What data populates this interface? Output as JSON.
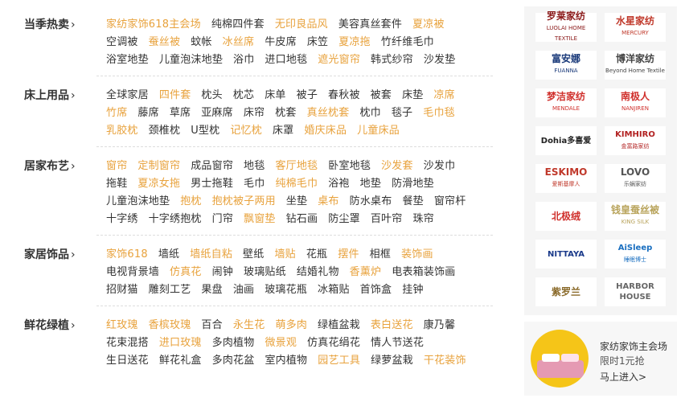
{
  "colors": {
    "highlight": "#e8a23c",
    "normal": "#333333",
    "separator": "#dddddd"
  },
  "categories": [
    {
      "title": "当季热卖",
      "rows": [
        [
          [
            "家纺家饰618主会场",
            true
          ],
          [
            "纯棉四件套",
            false
          ],
          [
            "无印良品风",
            true
          ],
          [
            "美容真丝套件",
            false
          ],
          [
            "夏凉被",
            true
          ]
        ],
        [
          [
            "空调被",
            false
          ],
          [
            "蚕丝被",
            true
          ],
          [
            "蚊帐",
            false
          ],
          [
            "冰丝席",
            true
          ],
          [
            "牛皮席",
            false
          ],
          [
            "床笠",
            false
          ],
          [
            "夏凉拖",
            true
          ],
          [
            "竹纤维毛巾",
            false
          ]
        ],
        [
          [
            "浴室地垫",
            false
          ],
          [
            "儿童泡沫地垫",
            false
          ],
          [
            "浴巾",
            false
          ],
          [
            "进口地毯",
            false
          ],
          [
            "遮光窗帘",
            true
          ],
          [
            "韩式纱帘",
            false
          ],
          [
            "沙发垫",
            false
          ]
        ]
      ]
    },
    {
      "title": "床上用品",
      "rows": [
        [
          [
            "全球家居",
            false
          ],
          [
            "四件套",
            true
          ],
          [
            "枕头",
            false
          ],
          [
            "枕芯",
            false
          ],
          [
            "床单",
            false
          ],
          [
            "被子",
            false
          ],
          [
            "春秋被",
            false
          ],
          [
            "被套",
            false
          ],
          [
            "床垫",
            false
          ],
          [
            "凉席",
            true
          ]
        ],
        [
          [
            "竹席",
            true
          ],
          [
            "藤席",
            false
          ],
          [
            "草席",
            false
          ],
          [
            "亚麻席",
            false
          ],
          [
            "床帘",
            false
          ],
          [
            "枕套",
            false
          ],
          [
            "真丝枕套",
            true
          ],
          [
            "枕巾",
            false
          ],
          [
            "毯子",
            false
          ],
          [
            "毛巾毯",
            true
          ]
        ],
        [
          [
            "乳胶枕",
            true
          ],
          [
            "颈椎枕",
            false
          ],
          [
            "U型枕",
            false
          ],
          [
            "记忆枕",
            true
          ],
          [
            "床罩",
            false
          ],
          [
            "婚庆床品",
            true
          ],
          [
            "儿童床品",
            true
          ]
        ]
      ]
    },
    {
      "title": "居家布艺",
      "rows": [
        [
          [
            "窗帘",
            true
          ],
          [
            "定制窗帘",
            true
          ],
          [
            "成品窗帘",
            false
          ],
          [
            "地毯",
            false
          ],
          [
            "客厅地毯",
            true
          ],
          [
            "卧室地毯",
            false
          ],
          [
            "沙发套",
            true
          ],
          [
            "沙发巾",
            false
          ]
        ],
        [
          [
            "拖鞋",
            false
          ],
          [
            "夏凉女拖",
            true
          ],
          [
            "男士拖鞋",
            false
          ],
          [
            "毛巾",
            false
          ],
          [
            "纯棉毛巾",
            true
          ],
          [
            "浴袍",
            false
          ],
          [
            "地垫",
            false
          ],
          [
            "防滑地垫",
            false
          ]
        ],
        [
          [
            "儿童泡沫地垫",
            false
          ],
          [
            "抱枕",
            true
          ],
          [
            "抱枕被子两用",
            true
          ],
          [
            "坐垫",
            false
          ],
          [
            "桌布",
            true
          ],
          [
            "防水桌布",
            false
          ],
          [
            "餐垫",
            false
          ],
          [
            "窗帘杆",
            false
          ]
        ],
        [
          [
            "十字绣",
            false
          ],
          [
            "十字绣抱枕",
            false
          ],
          [
            "门帘",
            false
          ],
          [
            "飘窗垫",
            true
          ],
          [
            "钻石画",
            false
          ],
          [
            "防尘罩",
            false
          ],
          [
            "百叶帘",
            false
          ],
          [
            "珠帘",
            false
          ]
        ]
      ]
    },
    {
      "title": "家居饰品",
      "rows": [
        [
          [
            "家饰618",
            true
          ],
          [
            "墙纸",
            false
          ],
          [
            "墙纸自粘",
            true
          ],
          [
            "壁纸",
            false
          ],
          [
            "墙贴",
            true
          ],
          [
            "花瓶",
            false
          ],
          [
            "摆件",
            true
          ],
          [
            "相框",
            false
          ],
          [
            "装饰画",
            true
          ]
        ],
        [
          [
            "电视背景墙",
            false
          ],
          [
            "仿真花",
            true
          ],
          [
            "闹钟",
            false
          ],
          [
            "玻璃贴纸",
            false
          ],
          [
            "结婚礼物",
            false
          ],
          [
            "香薰炉",
            true
          ],
          [
            "电表箱装饰画",
            false
          ]
        ],
        [
          [
            "招财猫",
            false
          ],
          [
            "雕刻工艺",
            false
          ],
          [
            "果盘",
            false
          ],
          [
            "油画",
            false
          ],
          [
            "玻璃花瓶",
            false
          ],
          [
            "冰箱贴",
            false
          ],
          [
            "首饰盒",
            false
          ],
          [
            "挂钟",
            false
          ]
        ]
      ]
    },
    {
      "title": "鲜花绿植",
      "rows": [
        [
          [
            "红玫瑰",
            true
          ],
          [
            "香槟玫瑰",
            true
          ],
          [
            "百合",
            false
          ],
          [
            "永生花",
            true
          ],
          [
            "萌多肉",
            true
          ],
          [
            "绿植盆栽",
            false
          ],
          [
            "表白送花",
            true
          ],
          [
            "康乃馨",
            false
          ]
        ],
        [
          [
            "花束混搭",
            false
          ],
          [
            "进口玫瑰",
            true
          ],
          [
            "多肉植物",
            false
          ],
          [
            "微景观",
            true
          ],
          [
            "仿真花绢花",
            false
          ],
          [
            "情人节送花",
            false
          ]
        ],
        [
          [
            "生日送花",
            false
          ],
          [
            "鲜花礼盒",
            false
          ],
          [
            "多肉花盆",
            false
          ],
          [
            "室内植物",
            false
          ],
          [
            "园艺工具",
            true
          ],
          [
            "绿萝盆栽",
            false
          ],
          [
            "干花装饰",
            true
          ]
        ]
      ]
    }
  ],
  "brands": [
    {
      "name": "罗莱家纺",
      "sub": "LUOLAI HOME TEXTILE",
      "color": "#8b1a1a",
      "icon": "luolai-logo"
    },
    {
      "name": "水星家纺",
      "sub": "MERCURY",
      "color": "#c0392b",
      "icon": "mercury-logo"
    },
    {
      "name": "富安娜",
      "sub": "FUANNA",
      "color": "#1a3a7a",
      "icon": "fuanna-logo"
    },
    {
      "name": "博洋家纺",
      "sub": "Beyond Home Textile",
      "color": "#444444",
      "icon": "beyond-logo"
    },
    {
      "name": "梦洁家纺",
      "sub": "MENDALE",
      "color": "#d0312d",
      "icon": "mendale-logo"
    },
    {
      "name": "南极人",
      "sub": "NANJIREN",
      "color": "#d0312d",
      "icon": "nanjiren-logo"
    },
    {
      "name": "Dohia多喜爱",
      "sub": "",
      "color": "#222222",
      "icon": "dohia-logo"
    },
    {
      "name": "KIMHIRO",
      "sub": "金富路家纺",
      "color": "#b22222",
      "icon": "kimhiro-logo"
    },
    {
      "name": "ESKIMO",
      "sub": "爱斯基摩人",
      "color": "#c0392b",
      "icon": "eskimo-logo"
    },
    {
      "name": "LOVO",
      "sub": "乐蜗家纺",
      "color": "#555555",
      "icon": "lovo-logo"
    },
    {
      "name": "北极绒",
      "sub": "",
      "color": "#d0312d",
      "icon": "beijirong-logo"
    },
    {
      "name": "钱皇蚕丝被",
      "sub": "KING SILK",
      "color": "#b8a35a",
      "icon": "kingsilk-logo"
    },
    {
      "name": "NITTAYA",
      "sub": "",
      "color": "#1a3a8a",
      "icon": "nittaya-logo"
    },
    {
      "name": "AiSleep",
      "sub": "睡眠博士",
      "color": "#1a6fc0",
      "icon": "aisleep-logo"
    },
    {
      "name": "紫罗兰",
      "sub": "",
      "color": "#8a6a2a",
      "icon": "zijing-logo"
    },
    {
      "name": "HARBOR HOUSE",
      "sub": "",
      "color": "#666666",
      "icon": "harborhouse-logo"
    }
  ],
  "promo": {
    "title": "家纺家饰主会场",
    "subtitle": "限时1元抢",
    "cta": "马上进入>"
  }
}
